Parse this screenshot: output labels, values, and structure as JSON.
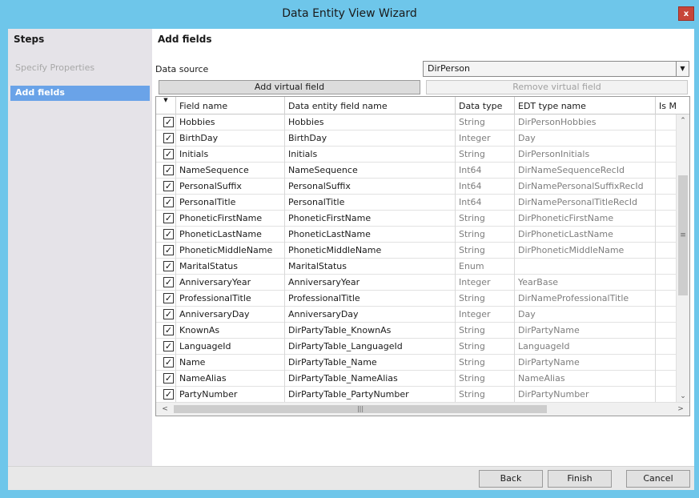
{
  "window": {
    "title": "Data Entity View Wizard",
    "close_label": "x"
  },
  "steps": {
    "heading": "Steps",
    "items": [
      {
        "label": "Specify Properties",
        "state": "disabled"
      },
      {
        "label": "Add fields",
        "state": "active"
      }
    ]
  },
  "main": {
    "heading": "Add fields",
    "data_source_label": "Data source",
    "data_source_value": "DirPerson",
    "add_virtual_field_label": "Add virtual field",
    "remove_virtual_field_label": "Remove virtual field"
  },
  "grid": {
    "columns": [
      "Field name",
      "Data entity field name",
      "Data type",
      "EDT type name",
      "Is M"
    ],
    "rows": [
      {
        "field": "Hobbies",
        "entity_field": "Hobbies",
        "type": "String",
        "edt": "DirPersonHobbies"
      },
      {
        "field": "BirthDay",
        "entity_field": "BirthDay",
        "type": "Integer",
        "edt": "Day"
      },
      {
        "field": "Initials",
        "entity_field": "Initials",
        "type": "String",
        "edt": "DirPersonInitials"
      },
      {
        "field": "NameSequence",
        "entity_field": "NameSequence",
        "type": "Int64",
        "edt": "DirNameSequenceRecId"
      },
      {
        "field": "PersonalSuffix",
        "entity_field": "PersonalSuffix",
        "type": "Int64",
        "edt": "DirNamePersonalSuffixRecId"
      },
      {
        "field": "PersonalTitle",
        "entity_field": "PersonalTitle",
        "type": "Int64",
        "edt": "DirNamePersonalTitleRecId"
      },
      {
        "field": "PhoneticFirstName",
        "entity_field": "PhoneticFirstName",
        "type": "String",
        "edt": "DirPhoneticFirstName"
      },
      {
        "field": "PhoneticLastName",
        "entity_field": "PhoneticLastName",
        "type": "String",
        "edt": "DirPhoneticLastName"
      },
      {
        "field": "PhoneticMiddleName",
        "entity_field": "PhoneticMiddleName",
        "type": "String",
        "edt": "DirPhoneticMiddleName"
      },
      {
        "field": "MaritalStatus",
        "entity_field": "MaritalStatus",
        "type": "Enum",
        "edt": ""
      },
      {
        "field": "AnniversaryYear",
        "entity_field": "AnniversaryYear",
        "type": "Integer",
        "edt": "YearBase"
      },
      {
        "field": "ProfessionalTitle",
        "entity_field": "ProfessionalTitle",
        "type": "String",
        "edt": "DirNameProfessionalTitle"
      },
      {
        "field": "AnniversaryDay",
        "entity_field": "AnniversaryDay",
        "type": "Integer",
        "edt": "Day"
      },
      {
        "field": "KnownAs",
        "entity_field": "DirPartyTable_KnownAs",
        "type": "String",
        "edt": "DirPartyName"
      },
      {
        "field": "LanguageId",
        "entity_field": "DirPartyTable_LanguageId",
        "type": "String",
        "edt": "LanguageId"
      },
      {
        "field": "Name",
        "entity_field": "DirPartyTable_Name",
        "type": "String",
        "edt": "DirPartyName"
      },
      {
        "field": "NameAlias",
        "entity_field": "DirPartyTable_NameAlias",
        "type": "String",
        "edt": "NameAlias"
      },
      {
        "field": "PartyNumber",
        "entity_field": "DirPartyTable_PartyNumber",
        "type": "String",
        "edt": "DirPartyNumber"
      }
    ]
  },
  "footer": {
    "back_label": "Back",
    "finish_label": "Finish",
    "cancel_label": "Cancel"
  }
}
